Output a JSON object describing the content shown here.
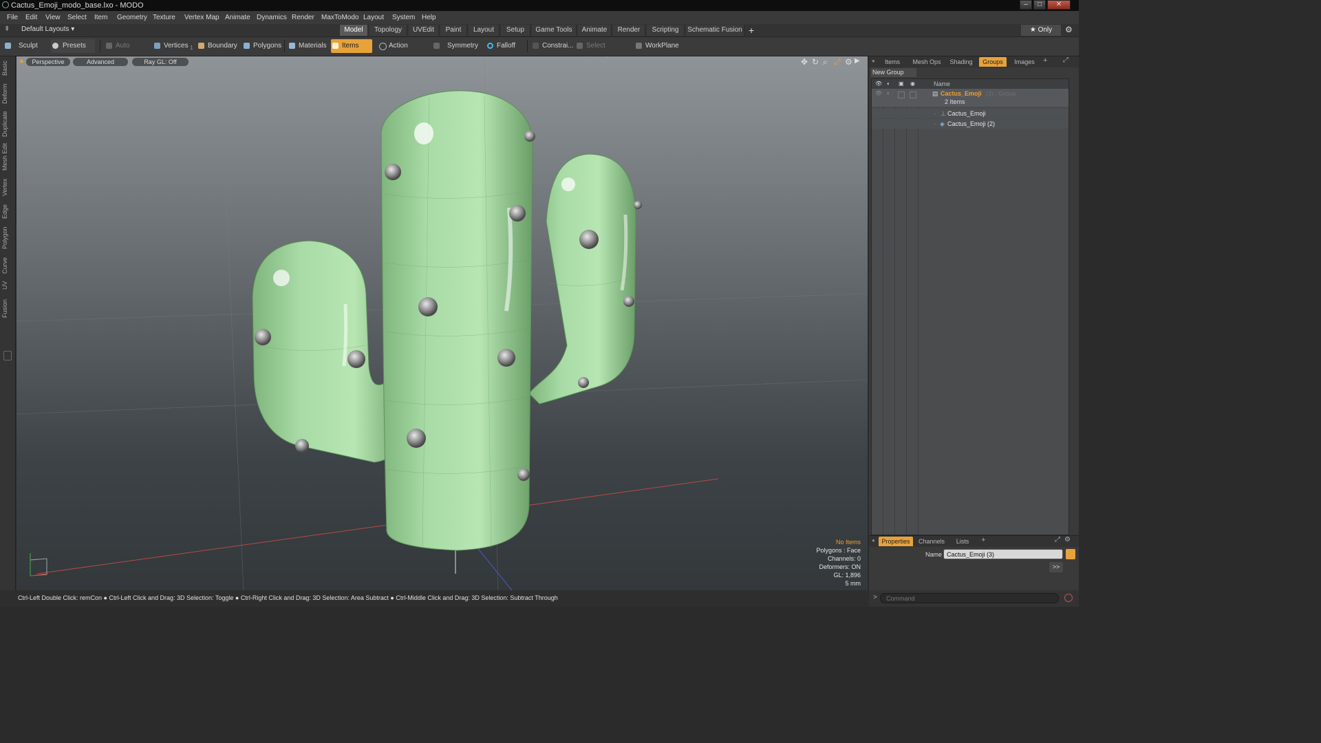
{
  "window": {
    "title": "Cactus_Emoji_modo_base.lxo - MODO",
    "min": "‒",
    "max": "□",
    "close": "✕"
  },
  "menu": [
    "File",
    "Edit",
    "View",
    "Select",
    "Item",
    "Geometry",
    "Texture",
    "Vertex Map",
    "Animate",
    "Dynamics",
    "Render",
    "MaxToModo",
    "Layout",
    "System",
    "Help"
  ],
  "layout_selector": "Default Layouts ▾",
  "layout_tabs": [
    "Model",
    "Topology",
    "UVEdit",
    "Paint",
    "Layout",
    "Setup",
    "Game Tools",
    "Animate",
    "Render",
    "Scripting",
    "Schematic Fusion"
  ],
  "layout_tabs_active": "Model",
  "add_tab": "+",
  "only_label": "★ Only",
  "toolbar": {
    "sculpt": "Sculpt",
    "presets": "Presets",
    "auto_select": "Auto Select",
    "vertices": "Vertices",
    "vertices_count": "1",
    "boundary": "Boundary",
    "polygons": "Polygons",
    "materials": "Materials",
    "items": "Items",
    "action_center": "Action Center",
    "symmetry": "Symmetry",
    "falloff": "Falloff",
    "constrain": "Constrai...",
    "select_through": "Select Through",
    "workplane": "WorkPlane"
  },
  "left_tabs": [
    "Basic",
    "Deform",
    "Duplicate",
    "Mesh Edit",
    "Vertex",
    "Edge",
    "Polygon",
    "Curve",
    "UV",
    "Fusion"
  ],
  "viewport": {
    "view_mode": "Perspective",
    "shading": "Advanced",
    "raygl": "Ray GL: Off",
    "stats": {
      "selection": "No Items",
      "polygons": "Polygons : Face",
      "channels": "Channels: 0",
      "deformers": "Deformers: ON",
      "gl": "GL: 1,896",
      "scale": "5 mm"
    }
  },
  "right_panel": {
    "tabs": [
      "Items",
      "Mesh Ops",
      "Shading",
      "Groups",
      "Images"
    ],
    "active_tab": "Groups",
    "add": "+",
    "new_group": "New Group",
    "column_name": "Name",
    "group": {
      "name": "Cactus_Emoji",
      "suffix": "(3) : Group",
      "count_label": "2 Items"
    },
    "children": [
      "Cactus_Emoji",
      "Cactus_Emoji (2)"
    ]
  },
  "properties": {
    "tabs": [
      "Properties",
      "Channels",
      "Lists"
    ],
    "active_tab": "Properties",
    "add": "+",
    "name_label": "Name",
    "name_value": "Cactus_Emoji (3)",
    "expand": ">>"
  },
  "status_bar": "Ctrl-Left Double Click: remCon ● Ctrl-Left Click and Drag: 3D Selection: Toggle ● Ctrl-Right Click and Drag: 3D Selection: Area Subtract ● Ctrl-Middle Click and Drag: 3D Selection: Subtract Through",
  "command": {
    "prompt": ">",
    "placeholder": "Command"
  },
  "colors": {
    "accent": "#e8a23a",
    "cactus": "#9dd49a",
    "spike": "#9c9c9c",
    "x_axis": "#c04040",
    "z_axis": "#4050c0"
  }
}
